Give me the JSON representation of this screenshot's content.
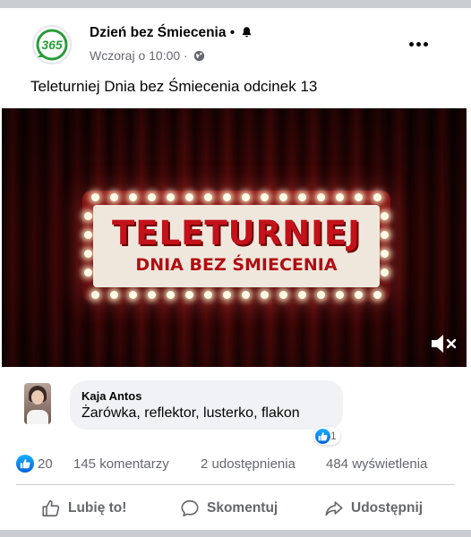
{
  "post": {
    "page_name": "Dzień bez Śmiecenia",
    "dot": " • ",
    "timestamp": "Wczoraj o 10:00",
    "meta_sep": " · ",
    "text": "Teleturniej Dnia bez Śmiecenia odcinek 13",
    "logo_text": "365"
  },
  "video": {
    "title_line1": "TELETURNIEJ",
    "title_line2": "DNIA BEZ ŚMIECENIA",
    "muted": true
  },
  "comment": {
    "author": "Kaja Antos",
    "text": "Żarówka, reflektor, lusterko, flakon",
    "reaction_count": "1"
  },
  "stats": {
    "likes": "20",
    "comments": "145 komentarzy",
    "shares": "2 udostępnienia",
    "views": "484 wyświetlenia"
  },
  "actions": {
    "like": "Lubię to!",
    "comment": "Skomentuj",
    "share": "Udostępnij"
  },
  "icons": {
    "bell": "bell-icon",
    "globe": "globe-icon",
    "more": "more-options-icon",
    "mute": "speaker-muted-icon",
    "like": "thumbs-up-icon",
    "comment": "comment-bubble-icon",
    "share": "share-arrow-icon"
  },
  "colors": {
    "accent_blue": "#1877f2",
    "secondary_text": "#65676b",
    "logo_green": "#2a9d3a"
  }
}
